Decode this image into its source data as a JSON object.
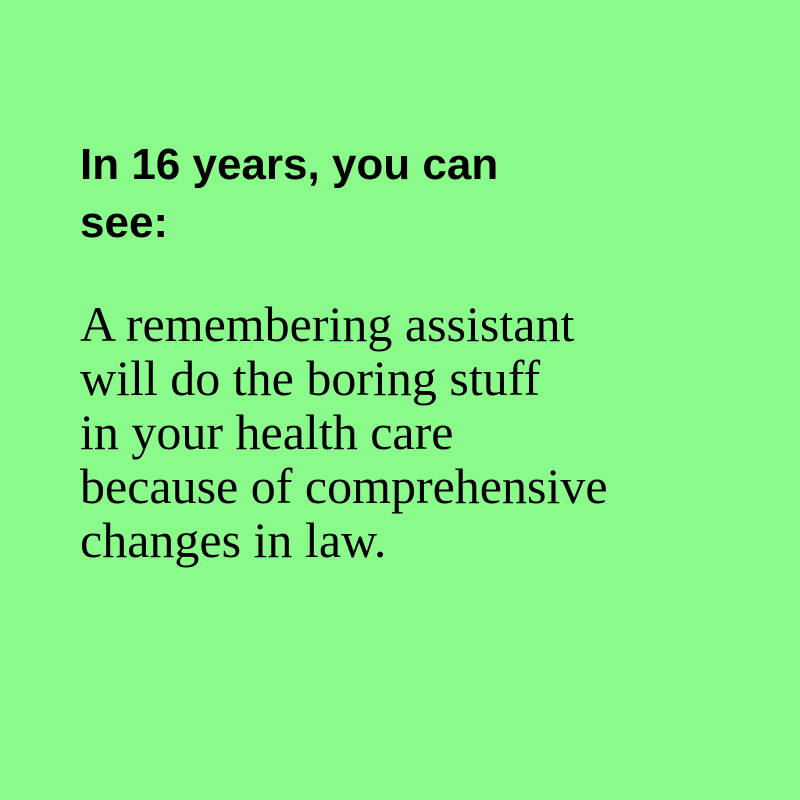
{
  "card": {
    "background_color": "#8AFA8A",
    "text_color": "#000000",
    "heading_lines": [
      "In 16 years, you can",
      "see:"
    ],
    "body_lines": [
      "A remembering assistant",
      "will do the boring stuff",
      "in your health care",
      "because of comprehensive",
      "changes in law."
    ]
  }
}
